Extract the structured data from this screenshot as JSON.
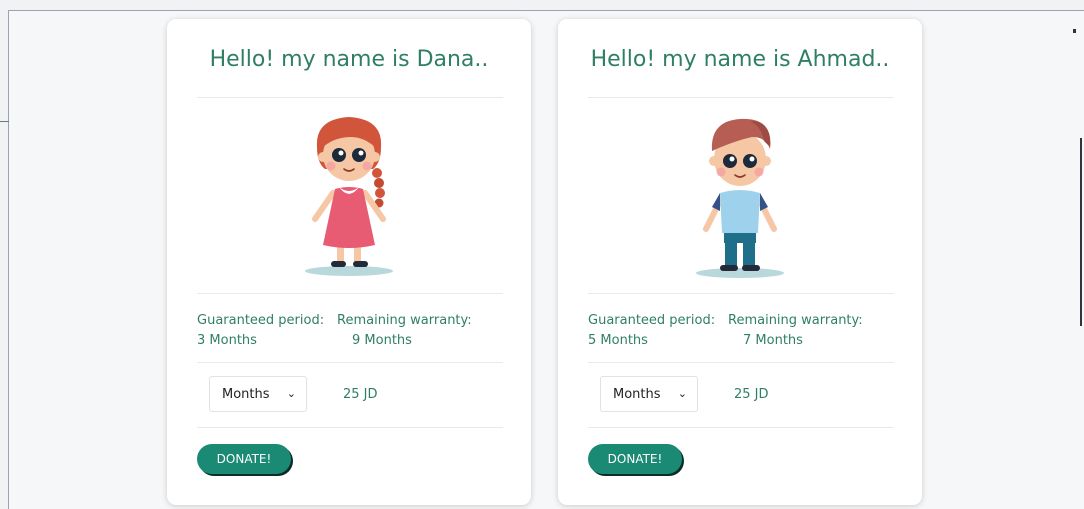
{
  "cards": [
    {
      "title": "Hello! my name is Dana..",
      "avatar": "girl-illustration",
      "guaranteed_label": "Guaranteed period:",
      "guaranteed_value": "3 Months",
      "remaining_label": "Remaining warranty:",
      "remaining_value": "9 Months",
      "select_value": "Months",
      "price": "25 JD",
      "donate_label": "DONATE!"
    },
    {
      "title": "Hello! my name is Ahmad..",
      "avatar": "boy-illustration",
      "guaranteed_label": "Guaranteed period:",
      "guaranteed_value": "5 Months",
      "remaining_label": "Remaining warranty:",
      "remaining_value": "7 Months",
      "select_value": "Months",
      "price": "25 JD",
      "donate_label": "DONATE!"
    }
  ],
  "colors": {
    "accent_text": "#2f7f64",
    "donate_button": "#1a8a74"
  }
}
